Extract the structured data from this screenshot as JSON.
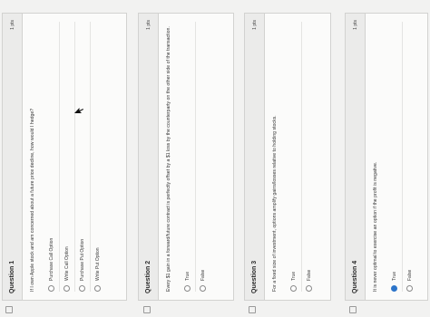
{
  "questions": [
    {
      "title": "Question 1",
      "points": "1 pts",
      "text": "If I own Apple stock and am concerned about a future price decline, how would I hedge?",
      "options": [
        {
          "label": "Purchase Call Option",
          "selected": false
        },
        {
          "label": "Write Call Option",
          "selected": false
        },
        {
          "label": "Purchase Put Option",
          "selected": false
        },
        {
          "label": "Write Put Option",
          "selected": false
        }
      ]
    },
    {
      "title": "Question 2",
      "points": "1 pts",
      "text": "Every $1 gain in a forward/future contract is perfectly offset by a $1 loss by the counterparty on the other side of the transaction.",
      "options": [
        {
          "label": "True",
          "selected": false
        },
        {
          "label": "False",
          "selected": false
        }
      ]
    },
    {
      "title": "Question 3",
      "points": "1 pts",
      "text": "For a fixed size of investment, options amplify gains/losses relative to holding stocks.",
      "options": [
        {
          "label": "True",
          "selected": false
        },
        {
          "label": "False",
          "selected": false
        }
      ]
    },
    {
      "title": "Question 4",
      "points": "1 pts",
      "text": "It is never optimal to exercise an option if the profit is negative.",
      "options": [
        {
          "label": "True",
          "selected": true
        },
        {
          "label": "False",
          "selected": false
        }
      ]
    }
  ]
}
